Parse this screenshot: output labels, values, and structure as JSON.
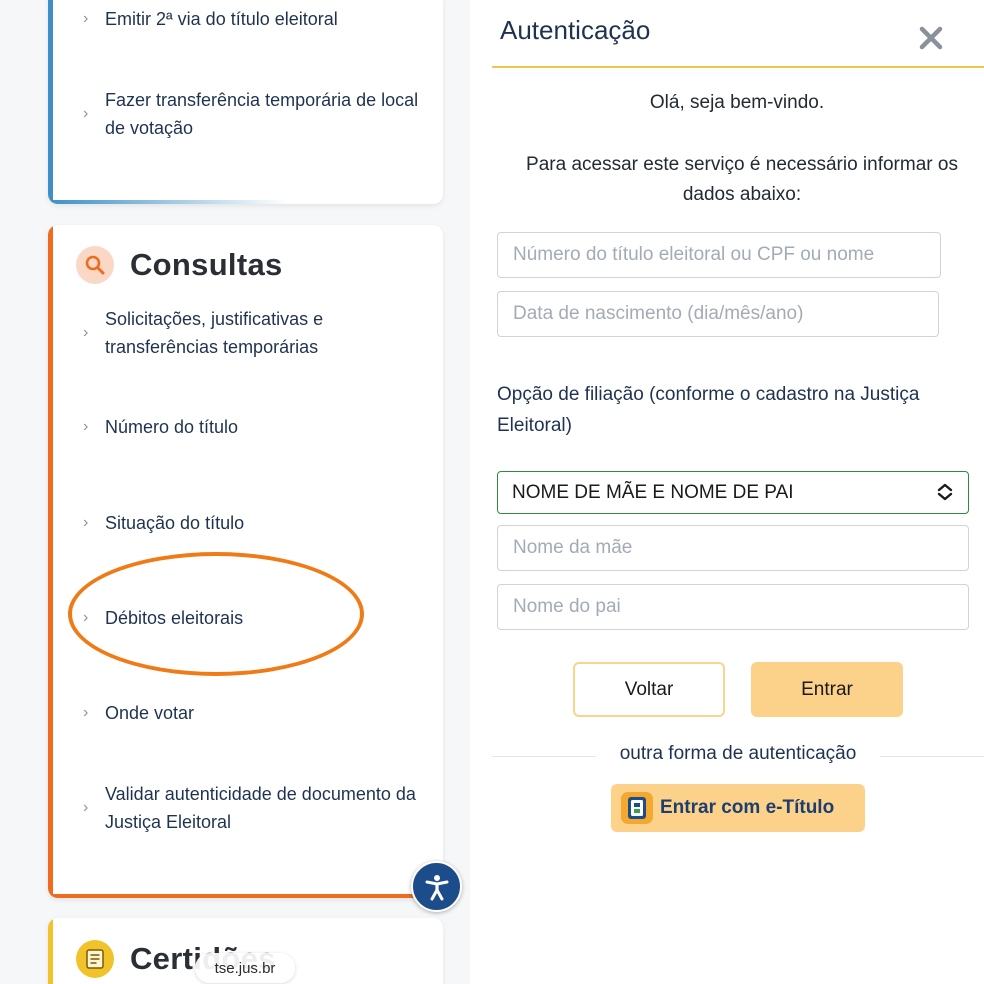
{
  "left": {
    "top_card": {
      "items": [
        "Emitir 2ª via do título eleitoral",
        "Fazer transferência temporária de local de votação"
      ]
    },
    "consultas": {
      "title": "Consultas",
      "icon": "search-icon",
      "accent": "#ee6b1f",
      "items": [
        "Solicitações, justificativas e transferências temporárias",
        "Número do título",
        "Situação do título",
        "Débitos eleitorais",
        "Onde votar",
        "Validar autenticidade de documento da Justiça Eleitoral"
      ]
    },
    "certidoes": {
      "title": "Certidões",
      "icon": "document-icon",
      "accent": "#f2c22b"
    },
    "url_bar": "tse.jus.br",
    "accessibility_icon": "accessibility-icon"
  },
  "modal": {
    "title": "Autenticação",
    "greeting": "Olá, seja bem-vindo.",
    "instructions": "Para acessar este serviço é necessário informar os dados abaixo:",
    "fields": {
      "titulo_placeholder": "Número do título eleitoral ou CPF ou nome",
      "nascimento_placeholder": "Data de nascimento (dia/mês/ano)",
      "mae_placeholder": "Nome da mãe",
      "pai_placeholder": "Nome do pai"
    },
    "filiacao_label": "Opção de filiação (conforme o cadastro na Justiça Eleitoral)",
    "filiacao_selected": "NOME DE MÃE E NOME DE PAI",
    "buttons": {
      "voltar": "Voltar",
      "entrar": "Entrar"
    },
    "other_auth": "outra forma de autenticação",
    "etitulo_button": "Entrar com e-Título",
    "accent_rule": "#f0c54a",
    "button_color": "#fcd18a"
  }
}
